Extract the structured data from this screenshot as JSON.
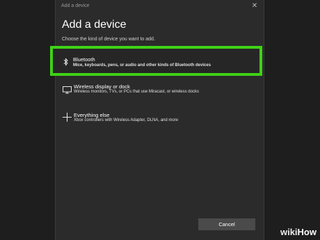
{
  "window": {
    "title": "Add a device",
    "close_icon": "close-icon"
  },
  "dialog": {
    "heading": "Add a device",
    "subheading": "Choose the kind of device you want to add."
  },
  "options": [
    {
      "icon": "bluetooth-icon",
      "name": "Bluetooth",
      "description": "Mice, keyboards, pens, or audio and other kinds of Bluetooth devices",
      "highlight_color": "#3fd316"
    },
    {
      "icon": "monitor-icon",
      "name": "Wireless display or dock",
      "description": "Wireless monitors, TVs, or PCs that use Miracast, or wireless docks"
    },
    {
      "icon": "plus-icon",
      "name": "Everything else",
      "description": "Xbox controllers with Wireless Adapter, DLNA, and more"
    }
  ],
  "footer": {
    "cancel_label": "Cancel"
  },
  "watermark": {
    "part1": "wiki",
    "part2": "How"
  }
}
